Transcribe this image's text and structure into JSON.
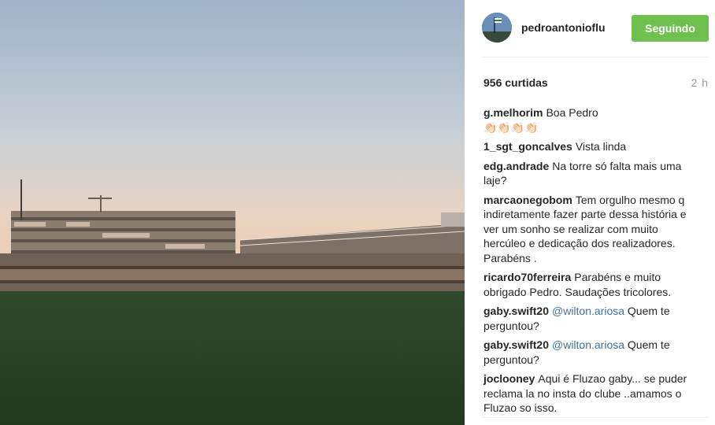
{
  "post": {
    "username": "pedroantonioflu",
    "follow_label": "Seguindo",
    "likes": "956 curtidas",
    "time": "2 h"
  },
  "comments": [
    {
      "user": "g.melhorim",
      "text": "Boa Pedro",
      "extra": "👏🏻👏🏻👏🏻👏🏻"
    },
    {
      "user": "1_sgt_goncalves",
      "text": "Vista linda"
    },
    {
      "user": "edg.andrade",
      "text": "Na torre só falta mais uma laje?"
    },
    {
      "user": "marcaonegobom",
      "text": "Tem orgulho mesmo q indiretamente fazer parte dessa história e ver um sonho se realizar com muito hercúleo e dedicação dos realizadores. Parabéns ."
    },
    {
      "user": "ricardo70ferreira",
      "text": "Parabéns e muito obrigado Pedro. Saudações tricolores."
    },
    {
      "user": "gaby.swift20",
      "mention": "@wilton.ariosa",
      "text": "Quem te perguntou?"
    },
    {
      "user": "gaby.swift20",
      "mention": "@wilton.ariosa",
      "text": "Quem te perguntou?"
    },
    {
      "user": "joclooney",
      "text": "Aqui é Fluzao gaby... se puder reclama la no insta do clube ..amamos o Fluzao so isso."
    }
  ],
  "colors": {
    "follow": "#70c050",
    "mention": "#3f729b"
  },
  "icons": {
    "avatar": "avatar-flag-icon"
  }
}
